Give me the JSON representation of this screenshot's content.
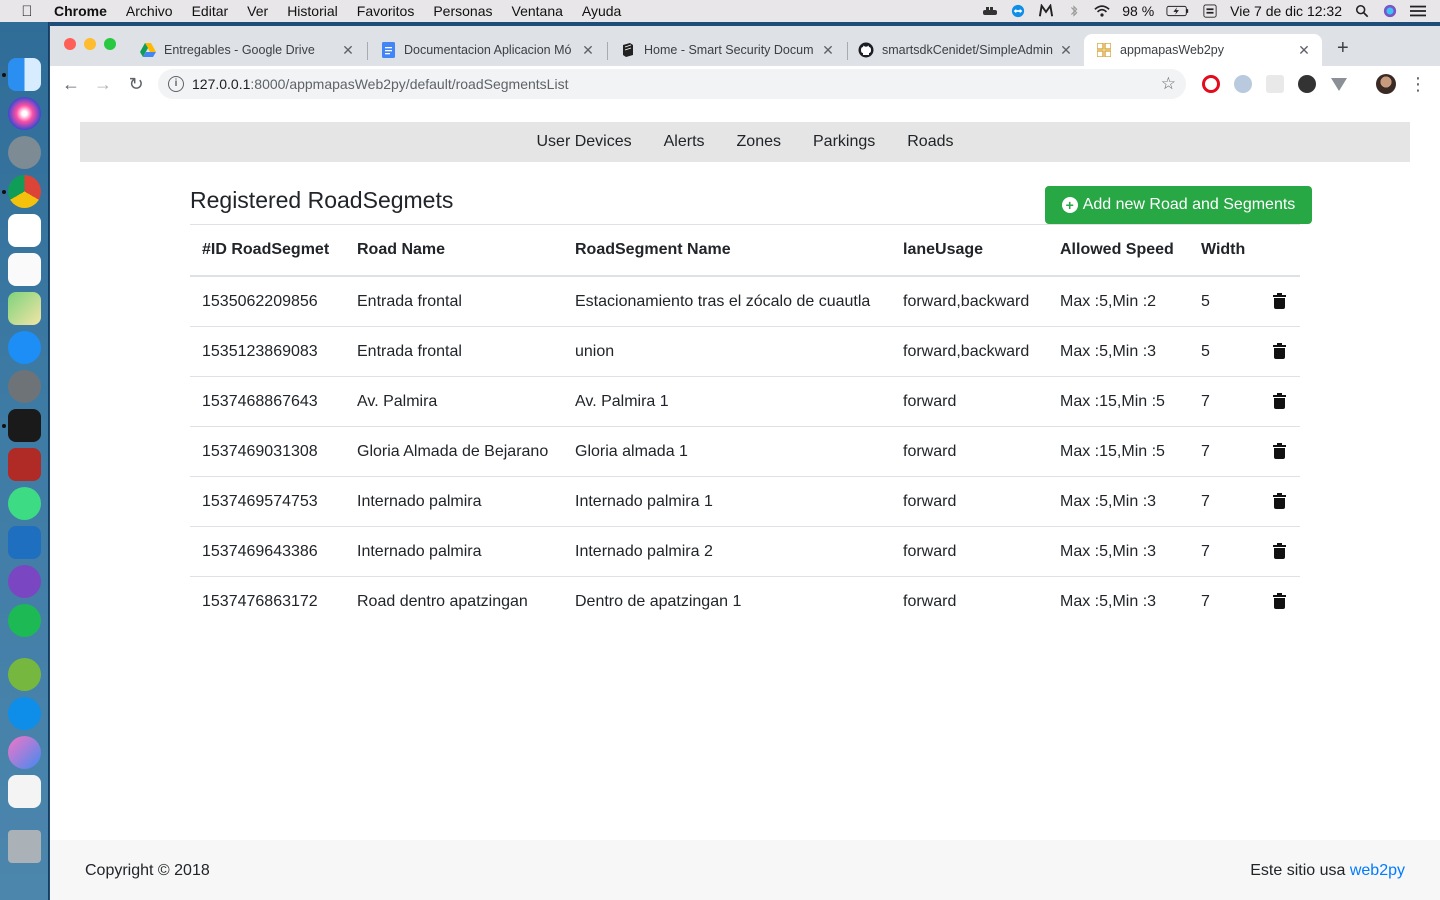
{
  "menubar": {
    "app": "Chrome",
    "items": [
      "Archivo",
      "Editar",
      "Ver",
      "Historial",
      "Favoritos",
      "Personas",
      "Ventana",
      "Ayuda"
    ],
    "battery": "98 %",
    "datetime": "Vie 7 de dic  12:32"
  },
  "tabs": [
    {
      "title": "Entregables - Google Drive",
      "icon": "google-drive-icon"
    },
    {
      "title": "Documentacion Aplicacion Mó",
      "icon": "google-docs-icon"
    },
    {
      "title": "Home - Smart Security Docum",
      "icon": "book-icon"
    },
    {
      "title": "smartsdkCenidet/SimpleAdmin",
      "icon": "github-icon"
    },
    {
      "title": "appmapasWeb2py",
      "icon": "web2py-icon"
    }
  ],
  "omnibox": {
    "host": "127.0.0.1",
    "path": ":8000/appmapasWeb2py/default/roadSegmentsList"
  },
  "nav": {
    "items": [
      "User Devices",
      "Alerts",
      "Zones",
      "Parkings",
      "Roads"
    ]
  },
  "main": {
    "title": "Registered RoadSegmets",
    "add_button": "Add new Road and Segments",
    "columns": [
      "#ID RoadSegmet",
      "Road Name",
      "RoadSegment Name",
      "laneUsage",
      "Allowed Speed",
      "Width"
    ],
    "rows": [
      [
        "1535062209856",
        "Entrada frontal",
        "Estacionamiento tras el zócalo de cuautla",
        "forward,backward",
        "Max :5,Min :2",
        "5"
      ],
      [
        "1535123869083",
        "Entrada frontal",
        "union",
        "forward,backward",
        "Max :5,Min :3",
        "5"
      ],
      [
        "1537468867643",
        "Av. Palmira",
        "Av. Palmira 1",
        "forward",
        "Max :15,Min :5",
        "7"
      ],
      [
        "1537469031308",
        "Gloria Almada de Bejarano",
        "Gloria almada 1",
        "forward",
        "Max :15,Min :5",
        "7"
      ],
      [
        "1537469574753",
        "Internado palmira",
        "Internado palmira 1",
        "forward",
        "Max :5,Min :3",
        "7"
      ],
      [
        "1537469643386",
        "Internado palmira",
        "Internado palmira 2",
        "forward",
        "Max :5,Min :3",
        "7"
      ],
      [
        "1537476863172",
        "Road dentro apatzingan",
        "Dentro de apatzingan 1",
        "forward",
        "Max :5,Min :3",
        "7"
      ]
    ]
  },
  "footer": {
    "copyright": "Copyright © 2018",
    "powered_prefix": "Este sitio usa",
    "powered_link": "web2py"
  },
  "colors": {
    "accent_green": "#28a745",
    "link_blue": "#007bff"
  }
}
